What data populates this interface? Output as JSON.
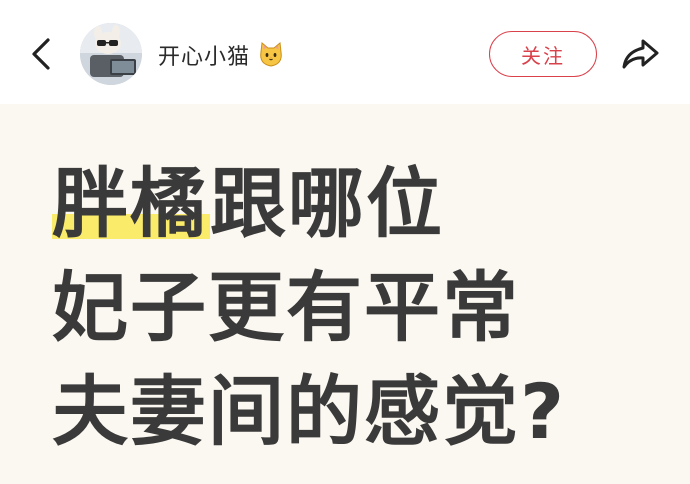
{
  "header": {
    "username": "开心小猫",
    "follow_label": "关注"
  },
  "icons": {
    "back": "chevron-left-icon",
    "share": "share-arrow-icon",
    "emoji": "cat-face-icon"
  },
  "colors": {
    "accent": "#d9414b",
    "highlight": "#fbeb6b",
    "content_bg": "#fbf8f1"
  },
  "post": {
    "title_line1_highlight": "胖橘",
    "title_line1_rest": "跟哪位",
    "title_line2": "妃子更有平常",
    "title_line3": "夫妻间的感觉?"
  }
}
